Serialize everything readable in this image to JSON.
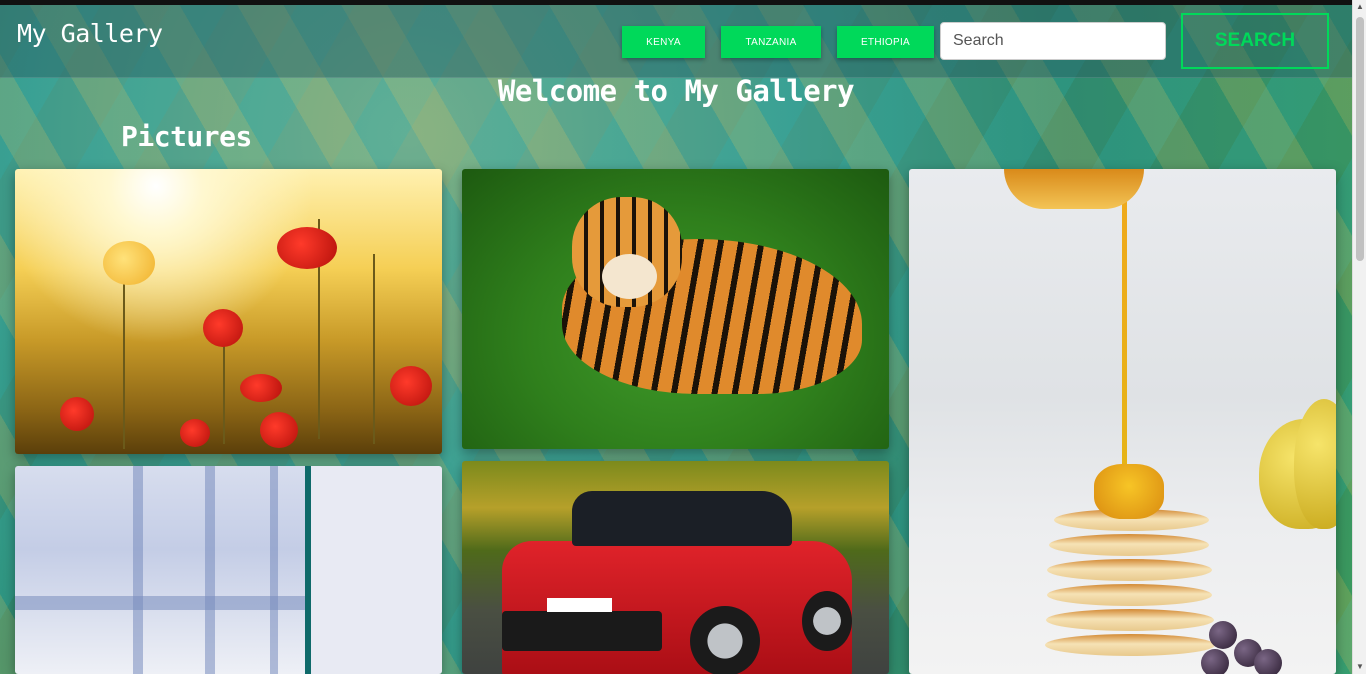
{
  "navbar": {
    "brand": "My Gallery",
    "countries": [
      "KENYA",
      "TANZANIA",
      "ETHIOPIA"
    ],
    "search_placeholder": "Search",
    "search_button": "SEARCH"
  },
  "main": {
    "welcome": "Welcome to My Gallery",
    "section_title": "Pictures"
  },
  "colors": {
    "accent": "#00d95a"
  }
}
